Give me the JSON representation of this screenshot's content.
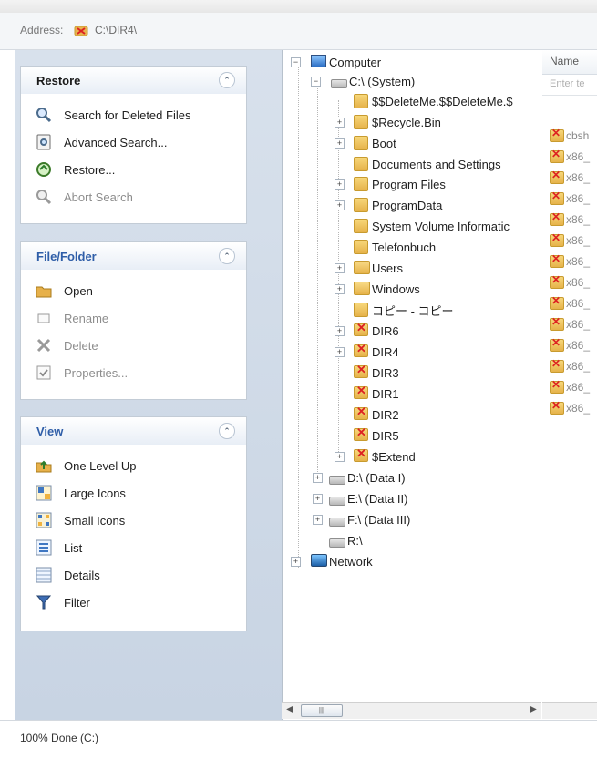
{
  "address": {
    "label": "Address:",
    "value": "C:\\DIR4\\"
  },
  "panels": {
    "restore": {
      "title": "Restore",
      "items": [
        {
          "label": "Search for Deleted Files",
          "icon": "search-icon"
        },
        {
          "label": "Advanced Search...",
          "icon": "advanced-search-icon"
        },
        {
          "label": "Restore...",
          "icon": "restore-icon"
        },
        {
          "label": "Abort Search",
          "icon": "abort-search-icon",
          "disabled": true
        }
      ]
    },
    "file_folder": {
      "title": "File/Folder",
      "items": [
        {
          "label": "Open",
          "icon": "open-folder-icon"
        },
        {
          "label": "Rename",
          "icon": "rename-icon",
          "disabled": true
        },
        {
          "label": "Delete",
          "icon": "delete-icon",
          "disabled": true
        },
        {
          "label": "Properties...",
          "icon": "properties-icon",
          "disabled": true
        }
      ]
    },
    "view": {
      "title": "View",
      "items": [
        {
          "label": "One Level Up",
          "icon": "one-level-up-icon"
        },
        {
          "label": "Large Icons",
          "icon": "large-icons-icon"
        },
        {
          "label": "Small Icons",
          "icon": "small-icons-icon"
        },
        {
          "label": "List",
          "icon": "list-icon"
        },
        {
          "label": "Details",
          "icon": "details-icon"
        },
        {
          "label": "Filter",
          "icon": "filter-icon"
        }
      ]
    }
  },
  "tree": [
    {
      "label": "Computer"
    },
    {
      "label": "C:\\  (System)"
    },
    {
      "label": "$$DeleteMe.$$DeleteMe.$"
    },
    {
      "label": "$Recycle.Bin"
    },
    {
      "label": "Boot"
    },
    {
      "label": "Documents and Settings"
    },
    {
      "label": "Program Files"
    },
    {
      "label": "ProgramData"
    },
    {
      "label": "System Volume Informatic"
    },
    {
      "label": "Telefonbuch"
    },
    {
      "label": "Users"
    },
    {
      "label": "Windows"
    },
    {
      "label": "コピー - コピー"
    },
    {
      "label": "DIR6"
    },
    {
      "label": "DIR4"
    },
    {
      "label": "DIR3"
    },
    {
      "label": "DIR1"
    },
    {
      "label": "DIR2"
    },
    {
      "label": "DIR5"
    },
    {
      "label": "$Extend"
    },
    {
      "label": "D:\\  (Data I)"
    },
    {
      "label": "E:\\  (Data II)"
    },
    {
      "label": "F:\\  (Data III)"
    },
    {
      "label": "R:\\"
    },
    {
      "label": "Network"
    }
  ],
  "list": {
    "column_name": "Name",
    "filter_placeholder": "Enter te",
    "rows": [
      "cbsh",
      "x86_",
      "x86_",
      "x86_",
      "x86_",
      "x86_",
      "x86_",
      "x86_",
      "x86_",
      "x86_",
      "x86_",
      "x86_",
      "x86_",
      "x86_"
    ]
  },
  "hscroll_grip": "|||",
  "status": "100% Done (C:)"
}
